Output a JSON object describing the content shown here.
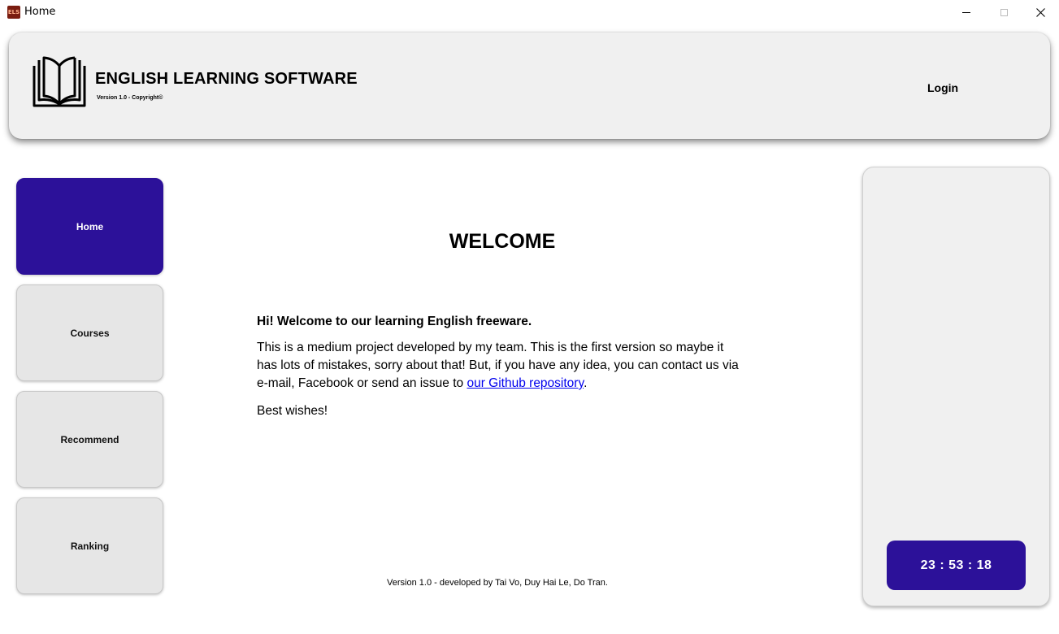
{
  "window": {
    "title": "Home",
    "icon_text": "ELS"
  },
  "header": {
    "app_name": "ENGLISH LEARNING SOFTWARE",
    "version_line": "Version 1.0 - Copyright©",
    "login_label": "Login"
  },
  "sidebar": {
    "items": [
      {
        "label": "Home",
        "active": true
      },
      {
        "label": "Courses",
        "active": false
      },
      {
        "label": "Recommend",
        "active": false
      },
      {
        "label": "Ranking",
        "active": false
      }
    ]
  },
  "main": {
    "title": "WELCOME",
    "lead": "Hi! Welcome to our learning English freeware.",
    "body_before_link": "This is a medium project developed by my team. This is the first version so maybe it has lots of mistakes, sorry about that! But, if you have any idea, you can contact us via e-mail, Facebook or send an issue to ",
    "link_text": "our Github repository",
    "body_after_link": ".",
    "closing": "Best wishes!",
    "footer": "Version 1.0 - developed by Tai Vo, Duy Hai Le, Do Tran."
  },
  "clock": {
    "time": "23 : 53 : 18"
  },
  "colors": {
    "accent": "#2c1199",
    "panel": "#f0f0f0",
    "button": "#e6e6e6",
    "link": "#0000ee"
  },
  "icons": {
    "logo": "open-book-icon",
    "minimize": "minimize-icon",
    "maximize": "maximize-icon",
    "close": "close-icon"
  }
}
